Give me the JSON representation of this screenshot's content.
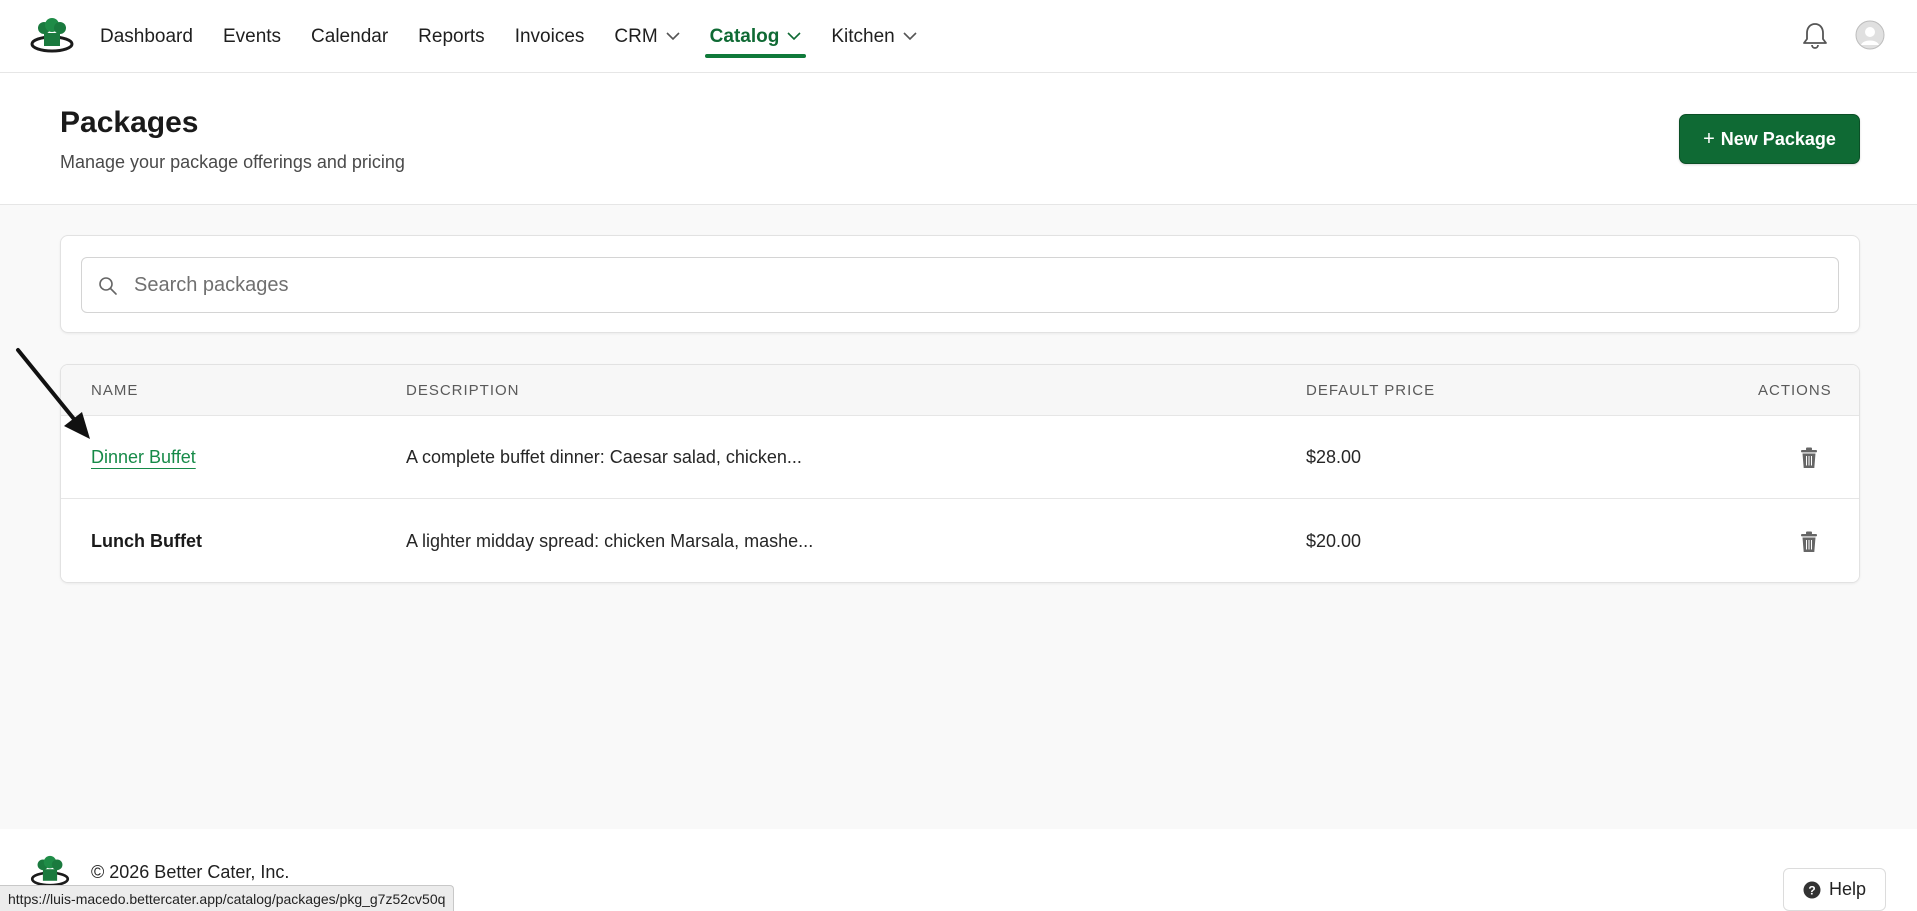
{
  "nav": {
    "items": [
      {
        "label": "Dashboard"
      },
      {
        "label": "Events"
      },
      {
        "label": "Calendar"
      },
      {
        "label": "Reports"
      },
      {
        "label": "Invoices"
      },
      {
        "label": "CRM"
      },
      {
        "label": "Catalog"
      },
      {
        "label": "Kitchen"
      }
    ],
    "active": "Catalog"
  },
  "page": {
    "title": "Packages",
    "subtitle": "Manage your package offerings and pricing",
    "new_button": "New Package"
  },
  "search": {
    "placeholder": "Search packages",
    "value": ""
  },
  "table": {
    "headers": {
      "name": "Name",
      "description": "Description",
      "price": "Default Price",
      "actions": "Actions"
    },
    "rows": [
      {
        "name": "Dinner Buffet",
        "description": "A complete buffet dinner: Caesar salad, chicken...",
        "price": "$28.00"
      },
      {
        "name": "Lunch Buffet",
        "description": "A lighter midday spread: chicken Marsala, mashe...",
        "price": "$20.00"
      }
    ]
  },
  "footer": {
    "copyright": "© 2026 Better Cater, Inc.",
    "help": "Help"
  },
  "status_url": "https://luis-macedo.bettercater.app/catalog/packages/pkg_g7z52cv50q",
  "colors": {
    "brand": "#0f6a34",
    "link": "#168a48",
    "background": "#f9f9f9"
  },
  "icons": [
    "chef-hat-logo-icon",
    "chevron-down-icon",
    "bell-icon",
    "user-avatar-icon",
    "search-icon",
    "trash-icon",
    "question-circle-icon",
    "arrow-annotation-icon"
  ]
}
